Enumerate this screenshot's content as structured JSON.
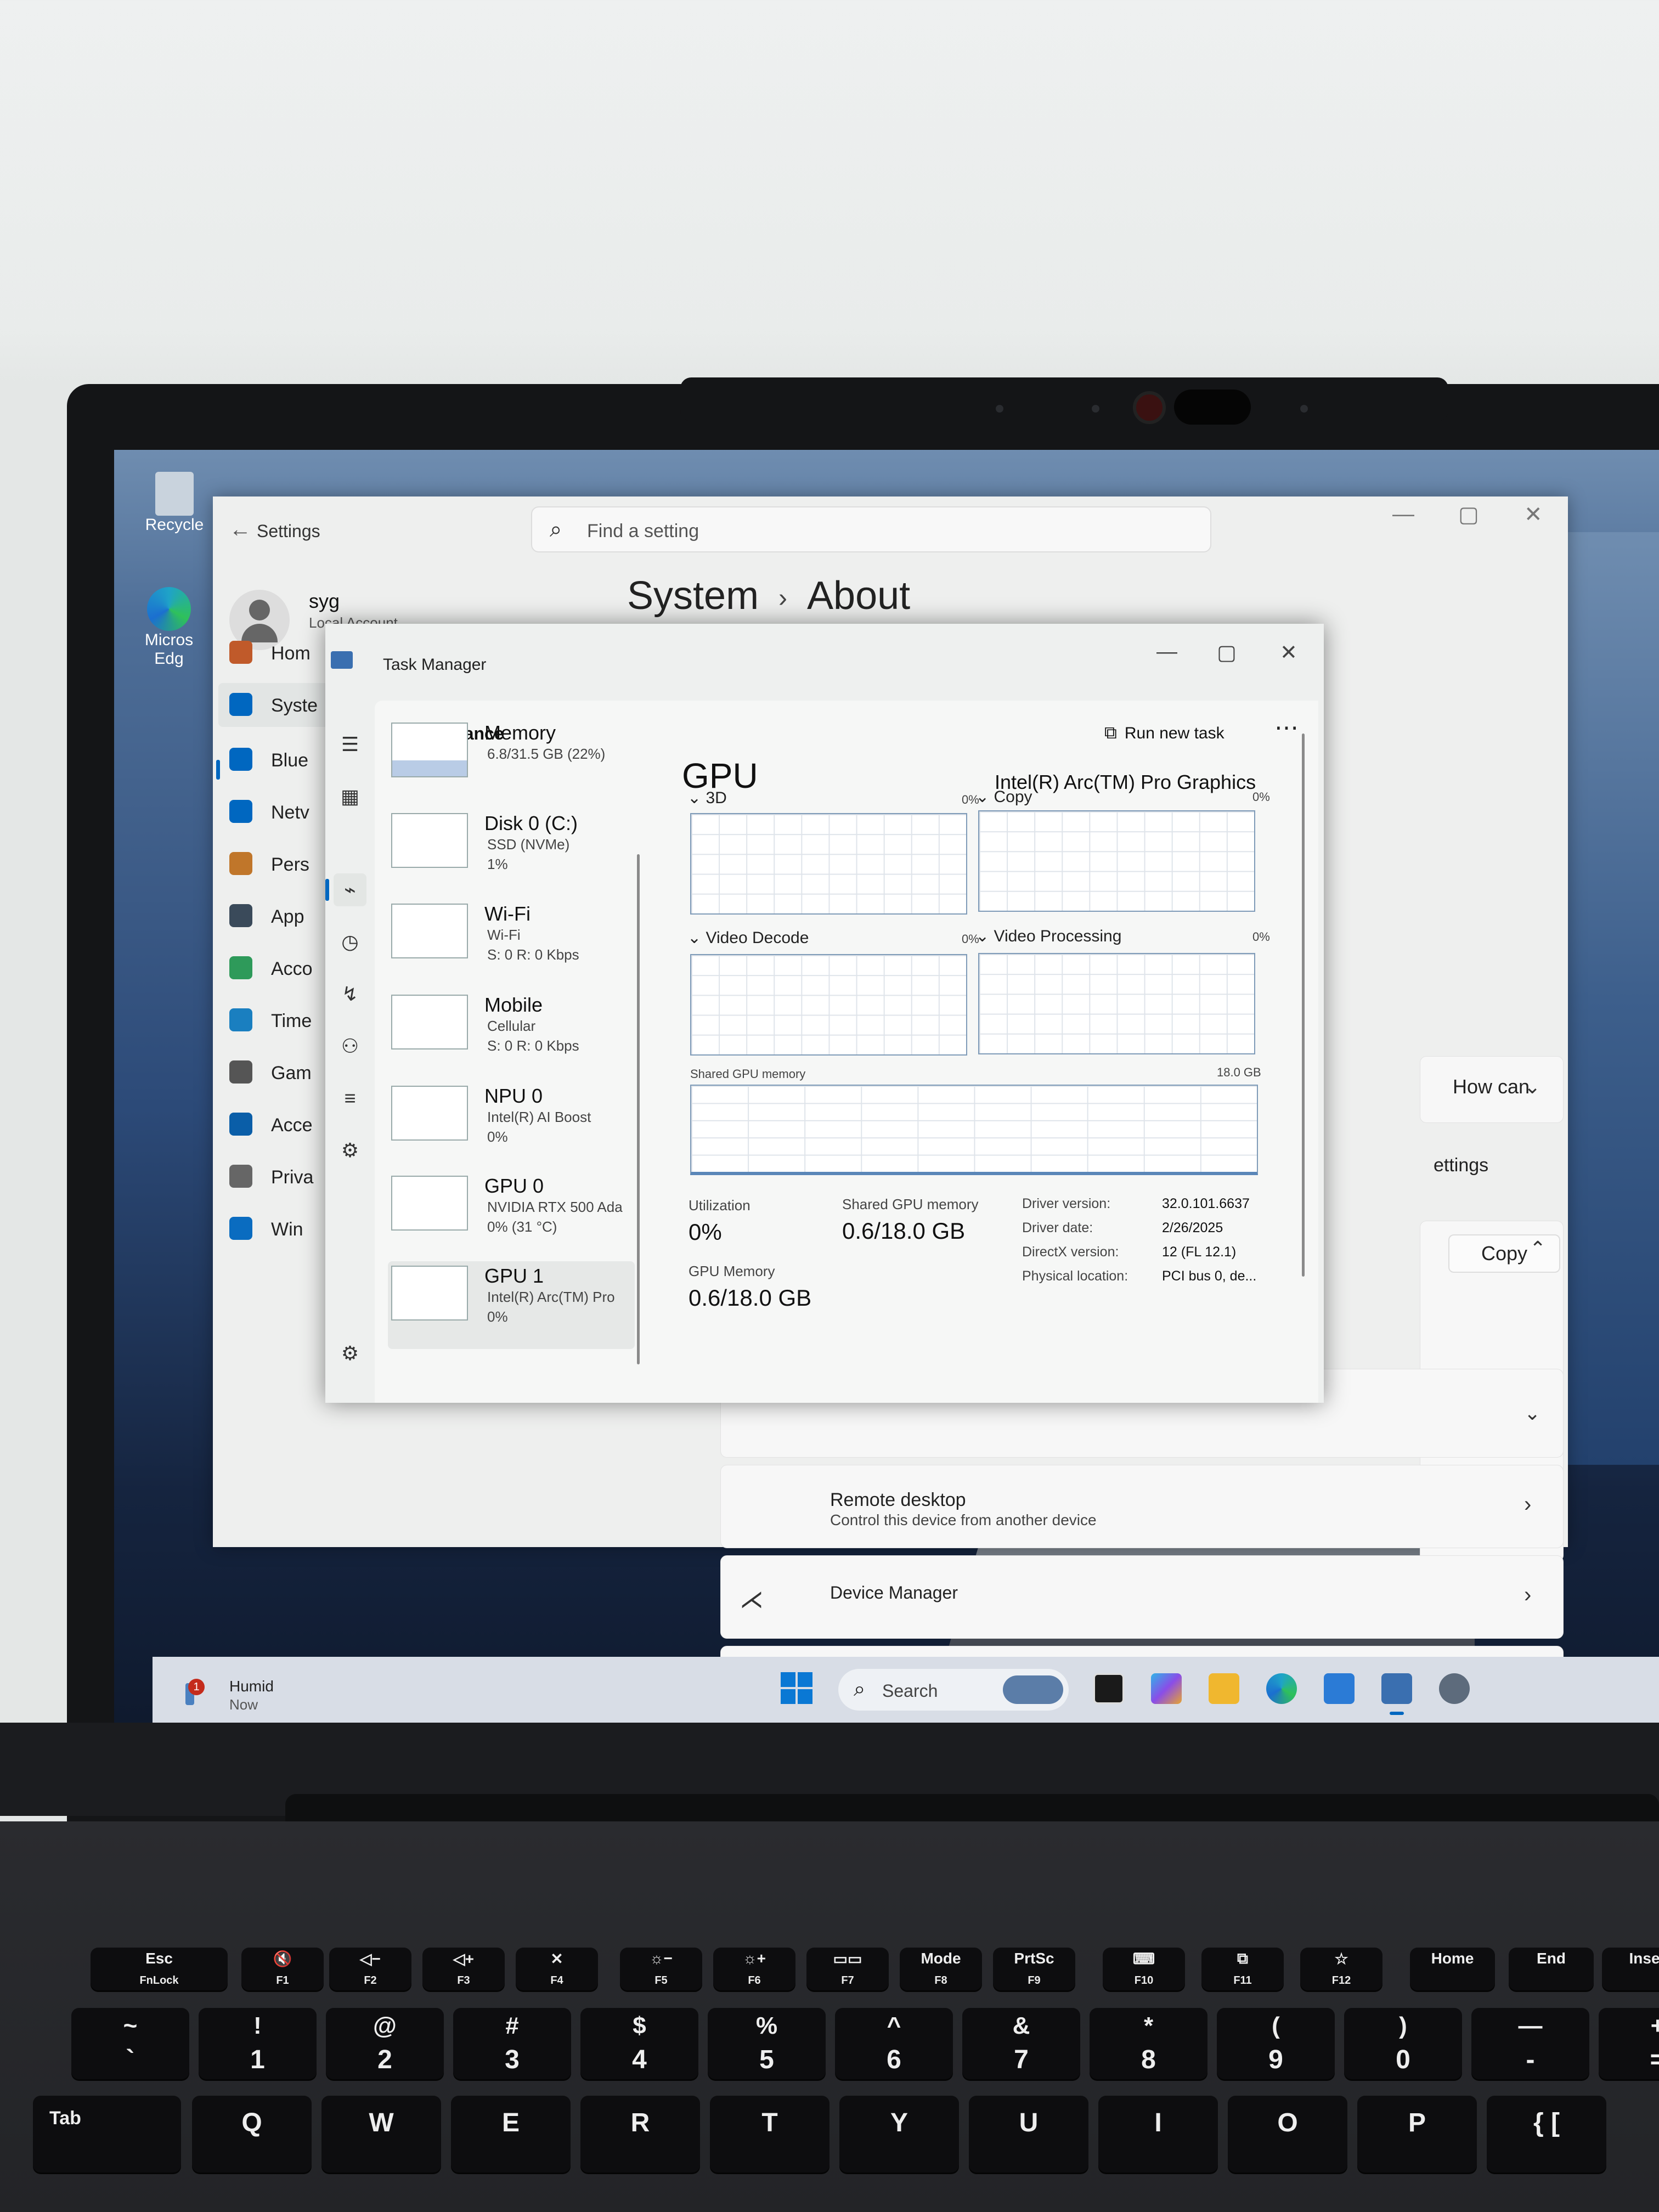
{
  "desktop": {
    "icons": [
      {
        "label": "Recycle",
        "icon": "recycle-bin-icon"
      },
      {
        "label": "Micros Edg",
        "icon": "edge-icon"
      }
    ]
  },
  "settings": {
    "title": "Settings",
    "search_placeholder": "Find a setting",
    "user": {
      "name": "syg",
      "account_type": "Local Account"
    },
    "breadcrumb": {
      "parent": "System",
      "current": "About"
    },
    "nav": [
      {
        "label": "Hom",
        "icon": "home-icon",
        "color": "#c05a2a"
      },
      {
        "label": "Syste",
        "icon": "system-icon",
        "color": "#0067c0"
      },
      {
        "label": "Blue",
        "icon": "bluetooth-icon",
        "color": "#0067c0"
      },
      {
        "label": "Netv",
        "icon": "wifi-icon",
        "color": "#0067c0"
      },
      {
        "label": "Pers",
        "icon": "brush-icon",
        "color": "#c0762a"
      },
      {
        "label": "App",
        "icon": "apps-icon",
        "color": "#3a4a5a"
      },
      {
        "label": "Acco",
        "icon": "account-icon",
        "color": "#2e9a5a"
      },
      {
        "label": "Time",
        "icon": "time-language-icon",
        "color": "#1a7fc0"
      },
      {
        "label": "Gam",
        "icon": "gaming-icon",
        "color": "#555"
      },
      {
        "label": "Acce",
        "icon": "accessibility-icon",
        "color": "#0a5ea8"
      },
      {
        "label": "Priva",
        "icon": "shield-icon",
        "color": "#666"
      },
      {
        "label": "Win",
        "icon": "windows-update-icon",
        "color": "#0a6cc0"
      }
    ],
    "right": {
      "how_can": "How can",
      "settings_link": "ettings",
      "copy_label": "Copy",
      "remote_desktop": {
        "title": "Remote desktop",
        "desc": "Control this device from another device"
      },
      "device_manager": "Device Manager"
    }
  },
  "task_manager": {
    "title": "Task Manager",
    "section": "Performance",
    "run_new_task": "Run new task",
    "devices": [
      {
        "name": "Memory",
        "sub1": "6.8/31.5 GB (22%)",
        "sub2": ""
      },
      {
        "name": "Disk 0 (C:)",
        "sub1": "SSD (NVMe)",
        "sub2": "1%"
      },
      {
        "name": "Wi-Fi",
        "sub1": "Wi-Fi",
        "sub2": "S: 0 R: 0 Kbps"
      },
      {
        "name": "Mobile",
        "sub1": "Cellular",
        "sub2": "S: 0 R: 0 Kbps"
      },
      {
        "name": "NPU 0",
        "sub1": "Intel(R) AI Boost",
        "sub2": "0%"
      },
      {
        "name": "GPU 0",
        "sub1": "NVIDIA RTX 500 Ada",
        "sub2": "0% (31 °C)"
      },
      {
        "name": "GPU 1",
        "sub1": "Intel(R) Arc(TM) Pro",
        "sub2": "0%"
      }
    ],
    "gpu": {
      "title": "GPU",
      "name": "Intel(R) Arc(TM) Pro Graphics",
      "engines": [
        {
          "label": "3D",
          "pct": "0%"
        },
        {
          "label": "Copy",
          "pct": "0%"
        },
        {
          "label": "Video Decode",
          "pct": "0%"
        },
        {
          "label": "Video Processing",
          "pct": "0%"
        }
      ],
      "shared_memory_label": "Shared GPU memory",
      "shared_memory_max": "18.0 GB",
      "stats": {
        "utilization_label": "Utilization",
        "utilization": "0%",
        "shared_label": "Shared GPU memory",
        "shared": "0.6/18.0 GB",
        "gpu_memory_label": "GPU Memory",
        "gpu_memory": "0.6/18.0 GB"
      },
      "info": [
        {
          "k": "Driver version:",
          "v": "32.0.101.6637"
        },
        {
          "k": "Driver date:",
          "v": "2/26/2025"
        },
        {
          "k": "DirectX version:",
          "v": "12 (FL 12.1)"
        },
        {
          "k": "Physical location:",
          "v": "PCI bus 0, de..."
        }
      ]
    }
  },
  "taskbar": {
    "weather": {
      "badge": "1",
      "title": "Humid",
      "sub": "Now"
    },
    "search_label": "Search",
    "apps": [
      "widget-icon",
      "terminal-icon",
      "copilot-icon",
      "file-explorer-icon",
      "edge-icon",
      "store-icon",
      "task-manager-icon",
      "settings-gear-icon"
    ]
  },
  "keyboard": {
    "fn_row": [
      {
        "top": "Esc",
        "bottom": "FnLock"
      },
      {
        "top": "🔇",
        "bottom": "F1"
      },
      {
        "top": "◁−",
        "bottom": "F2"
      },
      {
        "top": "◁+",
        "bottom": "F3"
      },
      {
        "top": "✕",
        "bottom": "F4"
      },
      {
        "top": "☼−",
        "bottom": "F5"
      },
      {
        "top": "☼+",
        "bottom": "F6"
      },
      {
        "top": "▭▭",
        "bottom": "F7"
      },
      {
        "top": "Mode",
        "bottom": "F8"
      },
      {
        "top": "PrtSc",
        "bottom": "F9"
      },
      {
        "top": "⌨",
        "bottom": "F10"
      },
      {
        "top": "⧉",
        "bottom": "F11"
      },
      {
        "top": "☆",
        "bottom": "F12"
      },
      {
        "top": "Home",
        "bottom": ""
      },
      {
        "top": "End",
        "bottom": ""
      },
      {
        "top": "Inse",
        "bottom": ""
      }
    ],
    "num_row": [
      {
        "top": "~",
        "bottom": "`"
      },
      {
        "top": "!",
        "bottom": "1"
      },
      {
        "top": "@",
        "bottom": "2"
      },
      {
        "top": "#",
        "bottom": "3"
      },
      {
        "top": "$",
        "bottom": "4"
      },
      {
        "top": "%",
        "bottom": "5"
      },
      {
        "top": "^",
        "bottom": "6"
      },
      {
        "top": "&",
        "bottom": "7"
      },
      {
        "top": "*",
        "bottom": "8"
      },
      {
        "top": "(",
        "bottom": "9"
      },
      {
        "top": ")",
        "bottom": "0"
      },
      {
        "top": "—",
        "bottom": "-"
      },
      {
        "top": "+",
        "bottom": "="
      }
    ],
    "q_row": [
      "Tab",
      "Q",
      "W",
      "E",
      "R",
      "T",
      "Y",
      "U",
      "I",
      "O",
      "P",
      "{ ["
    ]
  }
}
